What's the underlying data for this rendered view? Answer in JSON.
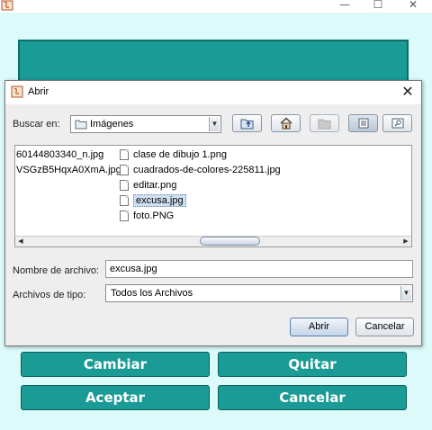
{
  "window": {
    "minimize_glyph": "—",
    "maximize_glyph": "☐",
    "close_glyph": "✕"
  },
  "main_buttons": {
    "cambiar": "Cambiar",
    "quitar": "Quitar",
    "aceptar": "Aceptar",
    "cancelar": "Cancelar"
  },
  "dialog": {
    "title": "Abrir",
    "close_glyph": "✕",
    "look_in_label": "Buscar en:",
    "look_in_value": "Imágenes",
    "files_left": [
      "60144803340_n.jpg",
      "VSGzB5HqxA0XmA.jpg"
    ],
    "files_right": [
      "clase de dibujo 1.png",
      "cuadrados-de-colores-225811.jpg",
      "editar.png",
      "excusa.jpg",
      "foto.PNG"
    ],
    "selected_file": "excusa.jpg",
    "filename_label": "Nombre de archivo:",
    "filename_value": "excusa.jpg",
    "filetype_label": "Archivos de tipo:",
    "filetype_value": "Todos los Archivos",
    "open_button": "Abrir",
    "cancel_button": "Cancelar"
  },
  "icons": [
    "java-icon",
    "folder-icon",
    "up-folder-icon",
    "home-icon",
    "new-folder-icon",
    "list-view-icon",
    "details-view-icon",
    "file-icon"
  ],
  "colors": {
    "teal": "#1a9b95",
    "background": "#dcfafa",
    "dialog": "#eeeeee"
  }
}
